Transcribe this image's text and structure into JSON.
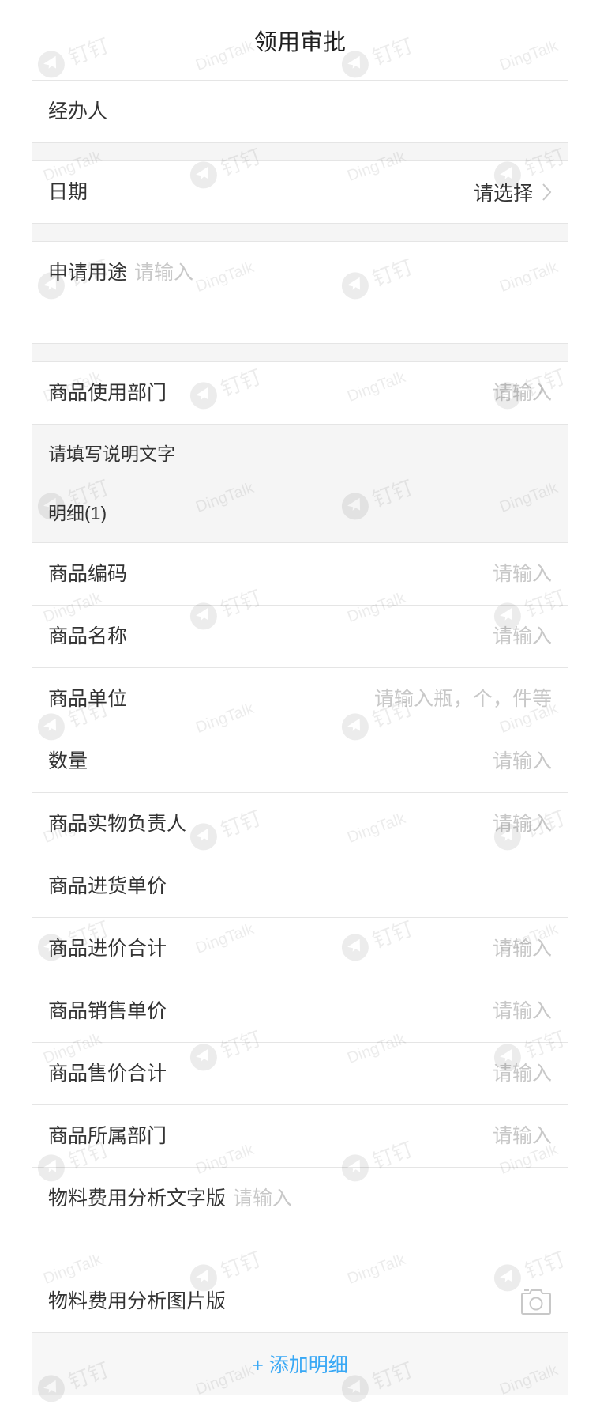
{
  "header": {
    "title": "领用审批"
  },
  "form": {
    "handler_label": "经办人",
    "date": {
      "label": "日期",
      "value": "请选择",
      "icon": "chevron-right-icon"
    },
    "purpose": {
      "label": "申请用途",
      "placeholder": "请输入"
    },
    "department": {
      "label": "商品使用部门",
      "placeholder": "请输入"
    },
    "note": "请填写说明文字"
  },
  "detail": {
    "title": "明细(1)",
    "fields": [
      {
        "label": "商品编码",
        "placeholder": "请输入"
      },
      {
        "label": "商品名称",
        "placeholder": "请输入"
      },
      {
        "label": "商品单位",
        "placeholder": "请输入瓶，个，件等"
      },
      {
        "label": "数量",
        "placeholder": "请输入"
      },
      {
        "label": "商品实物负责人",
        "placeholder": "请输入"
      },
      {
        "label": "商品进货单价"
      },
      {
        "label": "商品进价合计",
        "placeholder": "请输入"
      },
      {
        "label": "商品销售单价",
        "placeholder": "请输入"
      },
      {
        "label": "商品售价合计",
        "placeholder": "请输入"
      },
      {
        "label": "商品所属部门",
        "placeholder": "请输入"
      }
    ],
    "analysis_text": {
      "label": "物料费用分析文字版",
      "placeholder": "请输入"
    },
    "analysis_image": {
      "label": "物料费用分析图片版",
      "icon": "camera-icon"
    },
    "add_button": "+ 添加明细"
  },
  "watermark": {
    "brand": "钉钉",
    "text": "DingTalk",
    "icon": "dingtalk-logo-icon"
  },
  "colors": {
    "accent": "#38a8f5",
    "placeholder": "#c8c8c8",
    "section_bg": "#f5f5f5",
    "divider": "#e5e5e5",
    "text": "#333333"
  }
}
